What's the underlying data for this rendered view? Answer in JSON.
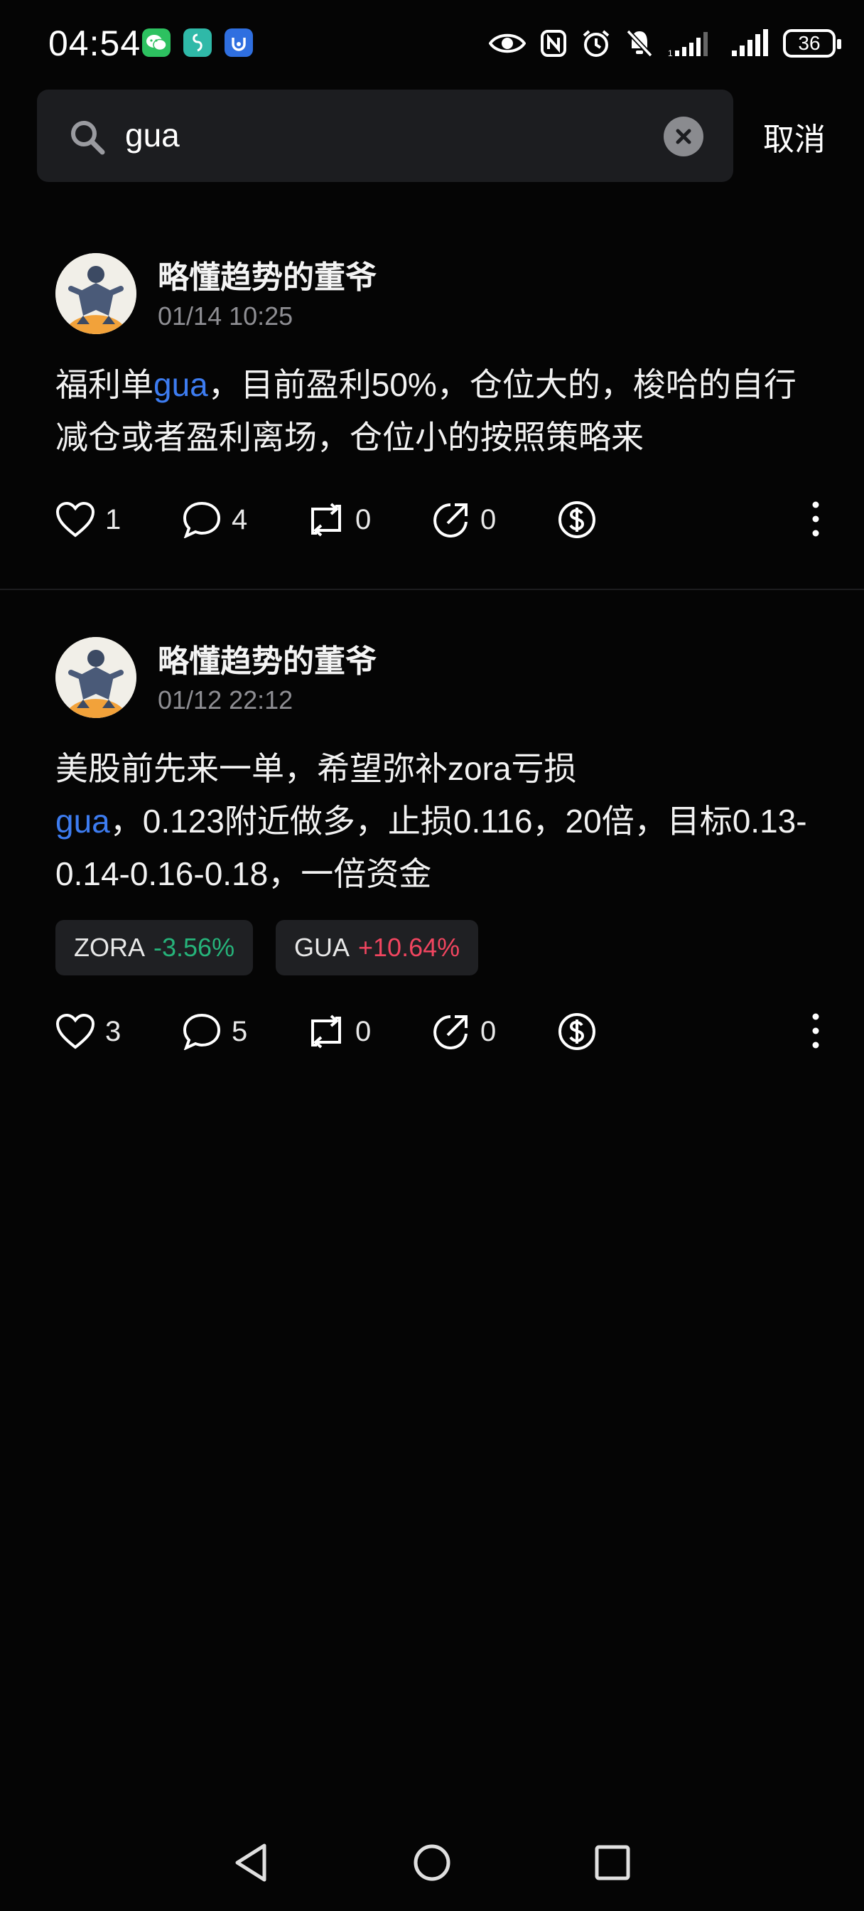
{
  "status_bar": {
    "time": "04:54",
    "battery": "36",
    "app_icons": [
      "wechat-icon",
      "app-icon-green",
      "app-icon-blue"
    ],
    "system_icons": [
      "eye-icon",
      "nfc-icon",
      "alarm-icon",
      "mute-icon",
      "signal-icon",
      "signal-icon"
    ]
  },
  "search": {
    "value": "gua",
    "cancel_label": "取消"
  },
  "posts": [
    {
      "author": "略懂趋势的董爷",
      "time": "01/14 10:25",
      "content": [
        {
          "text": "福利单",
          "hl": false
        },
        {
          "text": "gua",
          "hl": true
        },
        {
          "text": "，目前盈利50%，仓位大的，梭哈的自行减仓或者盈利离场，仓位小的按照策略来",
          "hl": false
        }
      ],
      "likes": "1",
      "comments": "4",
      "reposts": "0",
      "shares": "0"
    },
    {
      "author": "略懂趋势的董爷",
      "time": "01/12 22:12",
      "content_line1": "美股前先来一单，希望弥补zora亏损",
      "content_hl": "gua",
      "content_line2": "，0.123附近做多，止损0.116，20倍，目标0.13-0.14-0.16-0.18，一倍资金",
      "tags": [
        {
          "symbol": "ZORA",
          "change": "-3.56%",
          "direction": "down"
        },
        {
          "symbol": "GUA",
          "change": "+10.64%",
          "direction": "up"
        }
      ],
      "likes": "3",
      "comments": "5",
      "reposts": "0",
      "shares": "0"
    }
  ],
  "colors": {
    "background": "#050505",
    "highlight": "#3d7cf0",
    "down": "#26b37a",
    "up": "#f0455f",
    "avatar_ring": "#f2a23a"
  }
}
